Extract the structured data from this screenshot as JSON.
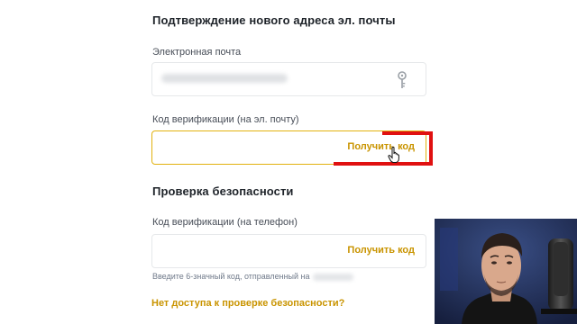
{
  "email_change": {
    "title": "Подтверждение нового адреса эл. почты",
    "email_label": "Электронная почта",
    "email_icon": "key-icon",
    "email_code_label": "Код верификации (на эл. почту)",
    "email_code_action": "Получить код"
  },
  "security_check": {
    "title": "Проверка безопасности",
    "phone_code_label": "Код верификации (на телефон)",
    "phone_code_action": "Получить код",
    "phone_hint": "Введите 6-значный код, отправленный на",
    "no_access_link": "Нет доступа к проверке безопасности?"
  },
  "colors": {
    "accent": "#c99400",
    "focus_border": "#e2b20f",
    "highlight": "#e01010"
  }
}
